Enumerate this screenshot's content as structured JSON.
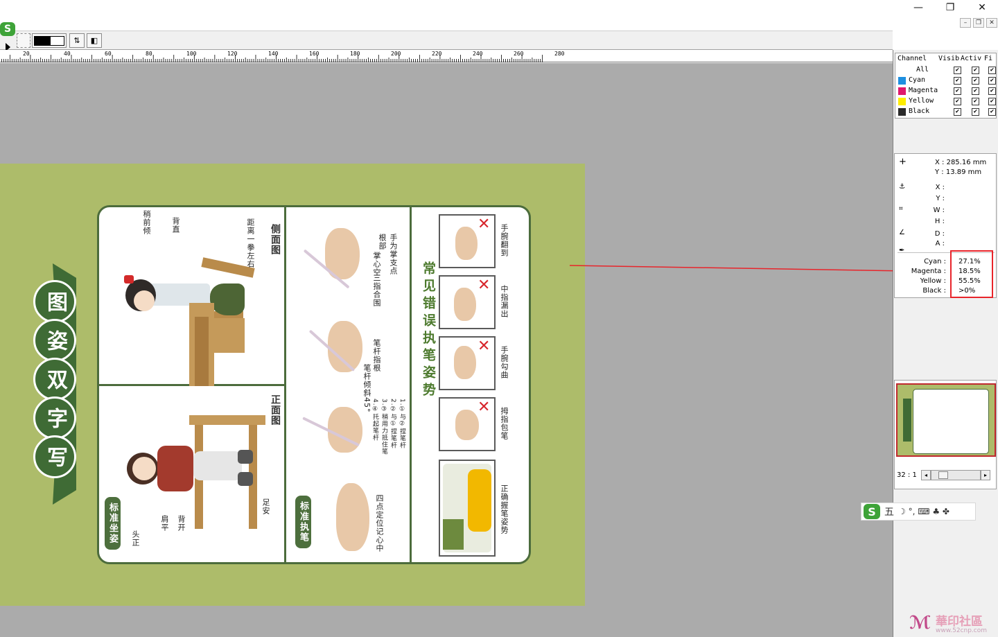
{
  "window": {
    "minimize": "—",
    "restore": "❐",
    "close": "✕",
    "mdi_minimize": "–",
    "mdi_restore": "❐",
    "mdi_close": "✕"
  },
  "ruler": {
    "labels": [
      "20",
      "40",
      "60",
      "80",
      "100",
      "120",
      "140",
      "160",
      "180",
      "200",
      "220",
      "240",
      "260",
      "280"
    ]
  },
  "channels": {
    "headers": [
      "Channel",
      "Visib",
      "Activ",
      "Fi"
    ],
    "rows": [
      {
        "name": "All",
        "color": ""
      },
      {
        "name": "Cyan",
        "color": "#1e8fe0"
      },
      {
        "name": "Magenta",
        "color": "#e0186c"
      },
      {
        "name": "Yellow",
        "color": "#ffee00"
      },
      {
        "name": "Black",
        "color": "#2a2a2a"
      }
    ]
  },
  "info": {
    "cursor_x": "X : 285.16 mm",
    "cursor_y": "Y : 13.89 mm",
    "labels": [
      "X :",
      "Y :",
      "W :",
      "H :",
      "D :",
      "A :"
    ],
    "ink": [
      {
        "label": "Cyan :",
        "value": "27.1%"
      },
      {
        "label": "Magenta :",
        "value": "18.5%"
      },
      {
        "label": "Yellow :",
        "value": "55.5%"
      },
      {
        "label": "Black :",
        "value": ">0%"
      }
    ]
  },
  "zoom": {
    "ratio": "32 : 1"
  },
  "ime": {
    "mode": "五",
    "symbols": "☽ °, ⌨ ♣ ✤"
  },
  "poster": {
    "title": "写字双姿图",
    "sections": {
      "sitting": "标准坐姿",
      "holding": "标准执笔",
      "errors": "常见错误执笔姿势"
    },
    "views": {
      "side": "侧面图",
      "front": "正面图"
    },
    "side_labels": [
      "稍前倾",
      "背直",
      "距离一拳左右"
    ],
    "front_labels": [
      "头正",
      "肩平",
      "背开",
      "足安"
    ],
    "hold_labels": {
      "top": "手为掌支点根部",
      "top2": "掌心空",
      "top3": "三指合围",
      "mid": "笔杆指根",
      "mid2": "笔杆倾斜45°",
      "low": "1.①与②捏笔杆 2.②与①捏笔杆 3.③稍用力抵住笔 4.④托起笔杆",
      "bottom": "四点定位记心中"
    },
    "errors": [
      "手腕翻到",
      "中指漏出",
      "手腕勾曲",
      "拇指包笔",
      "正确握笔姿势"
    ]
  },
  "watermark": {
    "text": "華印社區",
    "url": "www.52cnp.com"
  }
}
